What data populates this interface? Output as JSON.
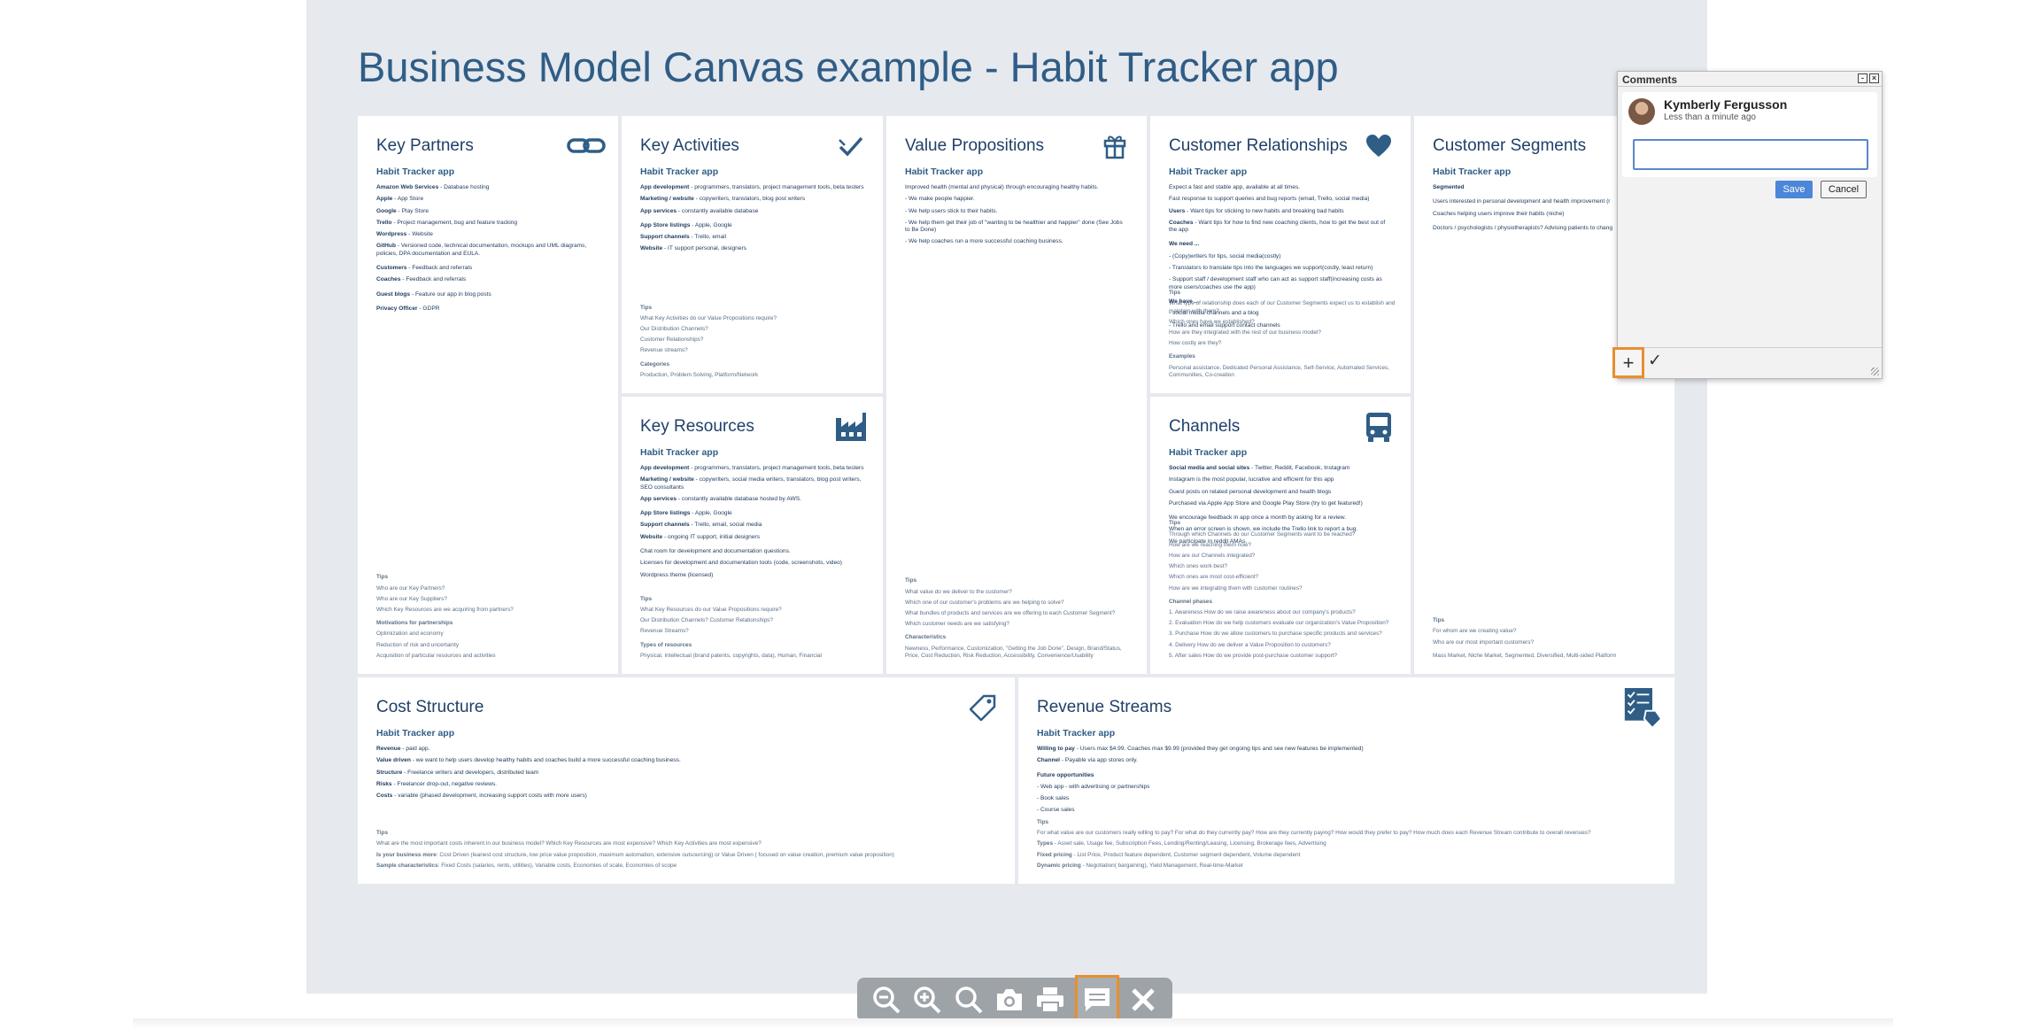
{
  "page_title": "Business Model Canvas example - Habit Tracker app",
  "canvas": {
    "key_partners": {
      "title": "Key Partners",
      "subtitle": "Habit Tracker app",
      "body": [
        "Amazon Web Services - Database hosting",
        "Apple - App Store",
        "Google - Play Store",
        "Trello - Project management, bug and feature tracking",
        "Wordpress - Website",
        "GitHub - Versioned code, technical documentation, mockups and UML diagrams, policies, DPA documentation and EULA.",
        "",
        "Customers - Feedback and referrals",
        "Coaches - Feedback and referrals",
        "",
        "Guest blogs - Feature our app in blog posts",
        "",
        "Privacy Officer - GDPR"
      ],
      "tips": [
        "Tips",
        "Who are our Key Partners?",
        "Who are our Key Suppliers?",
        "Which Key Resources are we acquiring from partners?",
        "",
        "Motivations for partnerships",
        "Optimization and economy",
        "Reduction of risk and uncertainty",
        "Acquisition of particular resources and activities"
      ]
    },
    "key_activities": {
      "title": "Key Activities",
      "subtitle": "Habit Tracker app",
      "body": [
        "App development - programmers, translators, project management tools, beta testers",
        "Marketing / website - copywriters, translators, blog post writers",
        "App services - constantly available database",
        "",
        "App Store listings - Apple, Google",
        "Support channels - Trello, email",
        "Website - IT support personal, designers"
      ],
      "tips": [
        "Tips",
        "What Key Activities do our Value Propositions require?",
        "Our Distribution Channels?",
        "Customer Relationships?",
        "Revenue streams?",
        "",
        "Categories",
        "Production, Problem Solving, Platform/Network"
      ]
    },
    "key_resources": {
      "title": "Key Resources",
      "subtitle": "Habit Tracker app",
      "body": [
        "App development - programmers, translators, project management tools, beta testers",
        "Marketing / website - copywriters, social media writers, translators, blog post writers, SEO consultants",
        "App services - constantly available database hosted by AWS.",
        "",
        "App Store listings - Apple, Google",
        "Support channels - Trello, email, social media",
        "Website - ongoing IT support, initial designers",
        "",
        "Chat room for development and documentation questions.",
        "Licenses for development and documentation tools (code, screenshots, video)",
        "Wordpress theme (licensed)"
      ],
      "tips": [
        "Tips",
        "What Key Resources do our Value Propositions require?",
        "Our Distribution Channels? Customer Relationships?",
        "Revenue Streams?",
        "",
        "Types of resources",
        "Physical, Intellectual (brand patents, copyrights, data), Human, Financial"
      ]
    },
    "value_propositions": {
      "title": "Value Propositions",
      "subtitle": "Habit Tracker app",
      "body": [
        "Improved health (mental and physical) through encouraging healthy habits.",
        "- We make people happier.",
        "- We help users stick to their habits.",
        "- We help them get their job of \"wanting to be healthier and happier\" done (See Jobs to Be Done)",
        "- We help coaches run a more successful coaching business."
      ],
      "tips": [
        "Tips",
        "What value do we deliver to the customer?",
        "Which one of our customer's problems are we helping to solve?",
        "What bundles of products and services are we offering to each Customer Segment?",
        "Which customer needs are we satisfying?",
        "",
        "Characteristics",
        "Newness, Performance, Customization, \"Getting the Job Done\", Design, Brand/Status, Price, Cost Reduction, Risk Reduction, Accessibility, Convenience/Usability"
      ]
    },
    "customer_relationships": {
      "title": "Customer Relationships",
      "subtitle": "Habit Tracker app",
      "body": [
        "Expect a fast and stable app, available at all times.",
        "Fast response to support queries and bug reports (email, Trello, social media)",
        "Users - Want tips for sticking to new habits and breaking bad habits",
        "Coaches - Want tips for how to find new coaching clients, how to get the best out of the app",
        "",
        "We need ...",
        "- (Copy)writers for tips, social media(costly)",
        "- Translators to translate tips into the languages we support(costly, least return)",
        "- Support staff / development staff who can act as support staff(increasing costs as more users/coaches use the app)",
        "",
        "We have ...",
        "- social media channels and a blog",
        "- Trello and email support contact channels"
      ],
      "tips": [
        "Tips",
        "What type of relationship does each of our Customer Segments expect us to establish and maintain with them?",
        "Which ones have we established?",
        "How are they integrated with the rest of our business model?",
        "How costly are they?",
        "",
        "Examples",
        "Personal assistance, Dedicated Personal Assistance, Self-Service, Automated Services, Communities, Co-creation"
      ]
    },
    "channels": {
      "title": "Channels",
      "subtitle": "Habit Tracker app",
      "body": [
        "Social media and social sites - Twitter, Reddit, Facebook, Instagram",
        "Instagram is the most popular, lucrative and efficient for this app",
        "Guest posts on related personal development and health blogs",
        "Purchased via Apple App Store and Google Play Store (try to get featured!)",
        "",
        "We encourage feedback in app once a month by asking for a review.",
        "When an error screen is shown, we include the Trello link to report a bug.",
        "We participate in reddit AMAs."
      ],
      "tips": [
        "Tips",
        "Through which Channels do our Customer Segments want to be reached?",
        "How are we reaching them now?",
        "How are our Channels integrated?",
        "Which ones work best?",
        "Which ones are most cost-efficient?",
        "How are we integrating them with customer routines?",
        "",
        "Channel phases",
        "1. Awareness   How do we raise awareness about our company's products?",
        "2. Evaluation   How do we help customers evaluate our organization's Value Proposition?",
        "3. Purchase   How do we allow customers to purchase specific products and services?",
        "4. Delivery   How do we deliver a Value Proposition to customers?",
        "5. After sales   How do we provide post-purchase customer support?"
      ]
    },
    "customer_segments": {
      "title": "Customer Segments",
      "subtitle": "Habit Tracker app",
      "body": [
        "Segmented",
        "",
        "Users interested in personal development and health improvement (r",
        "Coaches helping users improve their habits (niche)",
        "",
        "Doctors / psychologists / physiotherapists? Advising patients to chang"
      ],
      "tips": [
        "Tips",
        "For whom are we creating value?",
        "Who are our most important customers?",
        "",
        "Mass Market, Niche Market, Segmented, Diversified, Multi-sided Platform"
      ]
    },
    "cost_structure": {
      "title": "Cost Structure",
      "subtitle": "Habit Tracker app",
      "body": [
        "Revenue - paid app.",
        "Value driven - we want to help users develop healthy habits and coaches build a more successful coaching business.",
        "Structure - Freelance writers and developers, distributed team",
        "Risks - Freelancer drop-out, negative reviews.",
        "Costs - variable (phased development, increasing support costs with more users)"
      ],
      "tips": [
        "Tips",
        "What are the most important costs inherent in our business model? Which Key Resources are most expensive? Which Key Activities are most expensive?",
        "Is your business more:  Cost Driven (leanest cost structure, low price value proposition, maximum automation, extensive outsourcing) or Value Driven ( focused on value creation, premium value proposition)",
        "Sample characteristics:  Fixed Costs (salaries, rents, utilities), Variable costs, Economies of scale, Economies of scope"
      ]
    },
    "revenue_streams": {
      "title": "Revenue Streams",
      "subtitle": "Habit Tracker app",
      "body": [
        "Willing to pay - Users max $4.99.     Coaches max $9.99     (provided they get ongoing tips and see new features be implemented)",
        "Channel - Payable via app stores only.",
        "",
        "Future opportunities",
        "- Web app - with advertising or partnerships",
        "- Book sales",
        "- Course sales"
      ],
      "tips": [
        "Tips",
        "For what value are our customers really willing to pay? For what do they currently pay? How are they currently paying? How would they prefer to pay? How much does each Revenue Stream contribute to overall revenues?",
        "Types - Asset sale, Usage fee, Subscription Fees, Lending/Renting/Leasing, Licensing, Brokerage fees, Advertising",
        "Fixed pricing - List Price, Product feature dependent, Customer segment dependent, Volume dependent",
        "Dynamic pricing - Negotiation( bargaining), Yield Management, Real-time-Market"
      ]
    }
  },
  "comments_panel": {
    "title": "Comments",
    "author": "Kymberly Fergusson",
    "time": "Less than a minute ago",
    "input_value": "",
    "save_label": "Save",
    "cancel_label": "Cancel",
    "add_label": "+",
    "resolve_label": "✓"
  },
  "toolbar": {
    "buttons": [
      "zoom-out-icon",
      "zoom-in-icon",
      "zoom-reset-icon",
      "camera-icon",
      "print-icon",
      "comment-icon",
      "close-icon"
    ],
    "active": "comment-icon"
  },
  "colors": {
    "accent_orange": "#e88f2f",
    "title_blue": "#2f5d86",
    "stage_bg": "#e6e9ee",
    "save_blue": "#4c86d9"
  }
}
